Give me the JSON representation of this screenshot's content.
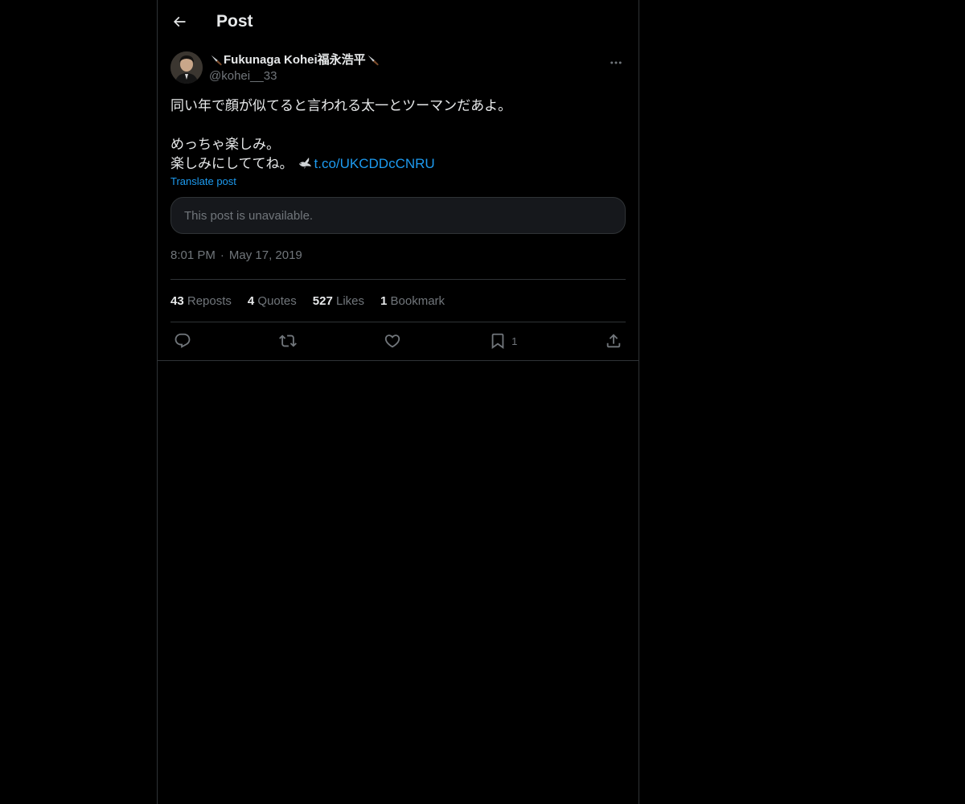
{
  "header": {
    "title": "Post"
  },
  "post": {
    "author": {
      "display_name": "Fukunaga Kohei福永浩平",
      "handle": "@kohei__33"
    },
    "text": {
      "line1": "同い年で顔が似てると言われる太一とツーマンだあよ。",
      "line2": "",
      "line3": "めっちゃ楽しみ。",
      "line4": "楽しみにしててね。",
      "link": "t.co/UKCDDcCNRU"
    },
    "translate_label": "Translate post",
    "quoted_card": "This post is unavailable.",
    "time": "8:01 PM",
    "date": "May 17, 2019",
    "separator": "·",
    "stats": {
      "reposts": {
        "count": "43",
        "label": "Reposts"
      },
      "quotes": {
        "count": "4",
        "label": "Quotes"
      },
      "likes": {
        "count": "527",
        "label": "Likes"
      },
      "bookmarks": {
        "count": "1",
        "label": "Bookmark"
      }
    },
    "actions": {
      "bookmark_count": "1"
    }
  },
  "icons": [
    "back-arrow-icon",
    "knife-icon",
    "more-icon",
    "dove-icon",
    "reply-icon",
    "repost-icon",
    "like-icon",
    "bookmark-icon",
    "share-icon"
  ],
  "colors": {
    "background": "#000000",
    "text": "#e7e9ea",
    "secondary": "#71767b",
    "accent": "#1d9bf0",
    "border": "#2f3336"
  }
}
